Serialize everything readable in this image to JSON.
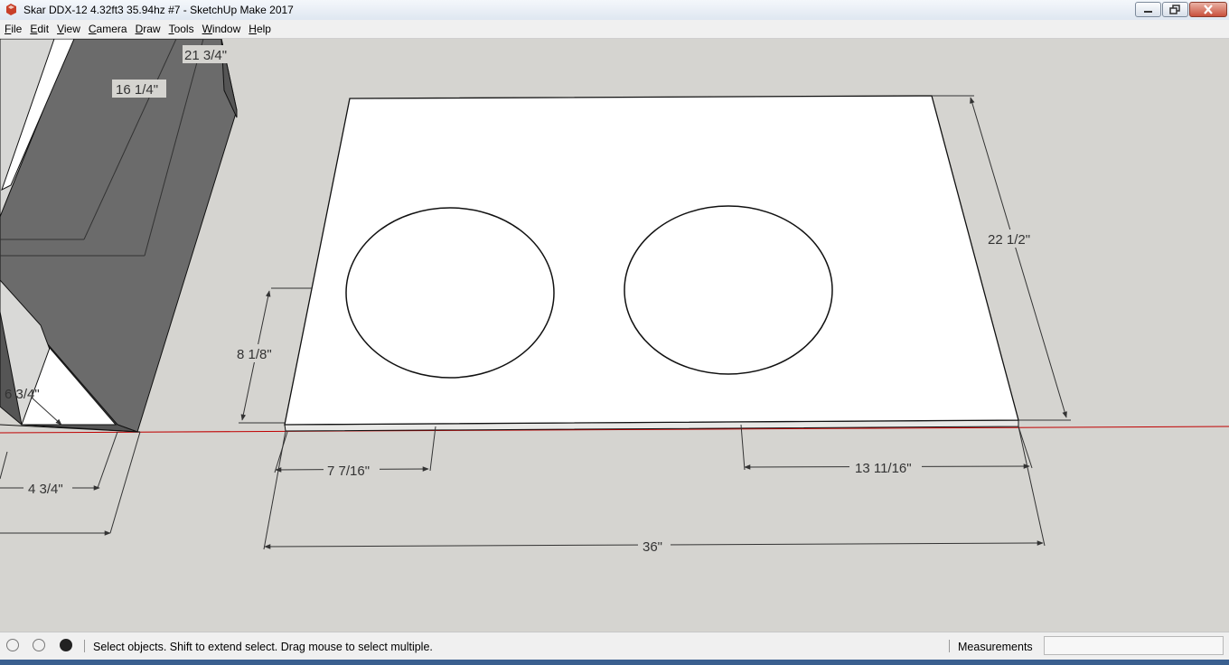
{
  "window": {
    "title": "Skar DDX-12 4.32ft3 35.94hz #7 - SketchUp Make 2017"
  },
  "menu": [
    {
      "key": "F",
      "rest": "ile"
    },
    {
      "key": "E",
      "rest": "dit"
    },
    {
      "key": "V",
      "rest": "iew"
    },
    {
      "key": "C",
      "rest": "amera"
    },
    {
      "key": "D",
      "rest": "raw"
    },
    {
      "key": "T",
      "rest": "ools"
    },
    {
      "key": "W",
      "rest": "indow"
    },
    {
      "key": "H",
      "rest": "elp"
    }
  ],
  "dimensions": {
    "d1": "21 3/4\"",
    "d2": "16 1/4\"",
    "d3": "6 3/4\"",
    "d4": "4 3/4\"",
    "d5": "8 1/8\"",
    "d6": "22 1/2\"",
    "d7": "7 7/16\"",
    "d8": "13 11/16\"",
    "d9": "36\""
  },
  "status": {
    "message": "Select objects. Shift to extend select. Drag mouse to select multiple.",
    "measurements_label": "Measurements",
    "measurements_value": ""
  },
  "colors": {
    "canvas": "#d5d4d0",
    "axis_red": "#c00000",
    "face_white": "#ffffff",
    "box_gray": "#6b6b6b"
  }
}
